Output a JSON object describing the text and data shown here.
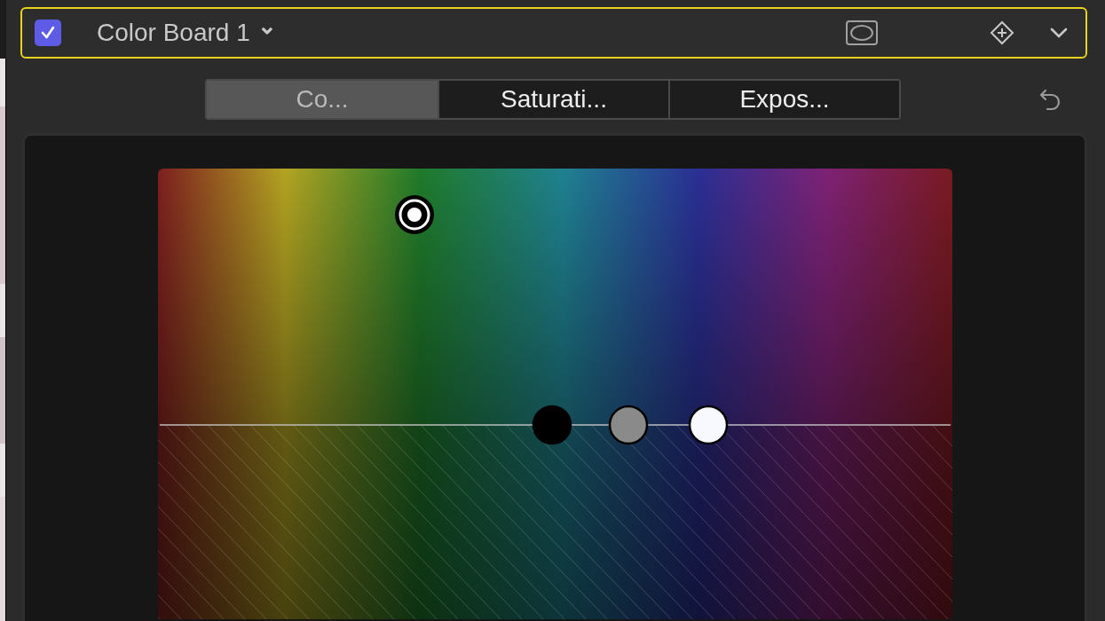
{
  "effect": {
    "enabled": true,
    "title": "Color Board 1",
    "chevron": "⌄"
  },
  "tabs": [
    {
      "label": "Co...",
      "selected": true
    },
    {
      "label": "Saturati...",
      "selected": false
    },
    {
      "label": "Expos...",
      "selected": false
    }
  ],
  "pucks": [
    {
      "kind": "global"
    },
    {
      "kind": "shadows"
    },
    {
      "kind": "midtones"
    },
    {
      "kind": "highlights"
    }
  ]
}
